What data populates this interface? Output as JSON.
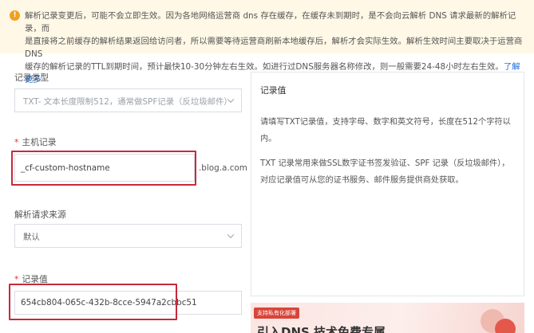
{
  "notice": {
    "icon": "warning-icon",
    "line1": "解析记录变更后，可能不会立即生效。因为各地网络运营商 dns 存在缓存，在缓存未到期时，是不会向云解析 DNS 请求最新的解析记录，而",
    "line2": "是直接将之前缓存的解析结果返回给访问者，所以需要等待运营商刷新本地缓存后，解析才会实际生效。解析生效时间主要取决于运营商DNS",
    "line3": "缓存的解析记录的TTL到期时间，预计最快10-30分钟左右生效。如进行过DNS服务器名称修改，则一般需要24-48小时左右生效。",
    "link": "了解更多"
  },
  "form": {
    "record_type": {
      "label": "记录类型",
      "value": "TXT- 文本长度限制512，通常做SPF记录（反垃圾邮件）"
    },
    "host": {
      "label": "主机记录",
      "required_mark": "*",
      "value": "_cf-custom-hostname",
      "suffix": ".blog.a.com"
    },
    "line": {
      "label": "解析请求来源",
      "value": "默认"
    },
    "record_value": {
      "label": "记录值",
      "required_mark": "*",
      "value": "654cb804-065c-432b-8cce-5947a2cbbc51"
    }
  },
  "side": {
    "title": "记录值",
    "p1": "请填写TXT记录值，支持字母、数字和英文符号，长度在512个字符以内。",
    "p2": "TXT 记录常用来做SSL数字证书签发验证、SPF 记录（反垃圾邮件），对应记录值可从您的证书服务、邮件服务提供商处获取。"
  },
  "promo": {
    "badge": "支持私有化部署",
    "text": "引入DNS 技术免费专属"
  },
  "colors": {
    "highlight": "#c62a3c",
    "link": "#1f6fe0",
    "notice_bg": "#fff8e6",
    "required": "#e2333a"
  }
}
